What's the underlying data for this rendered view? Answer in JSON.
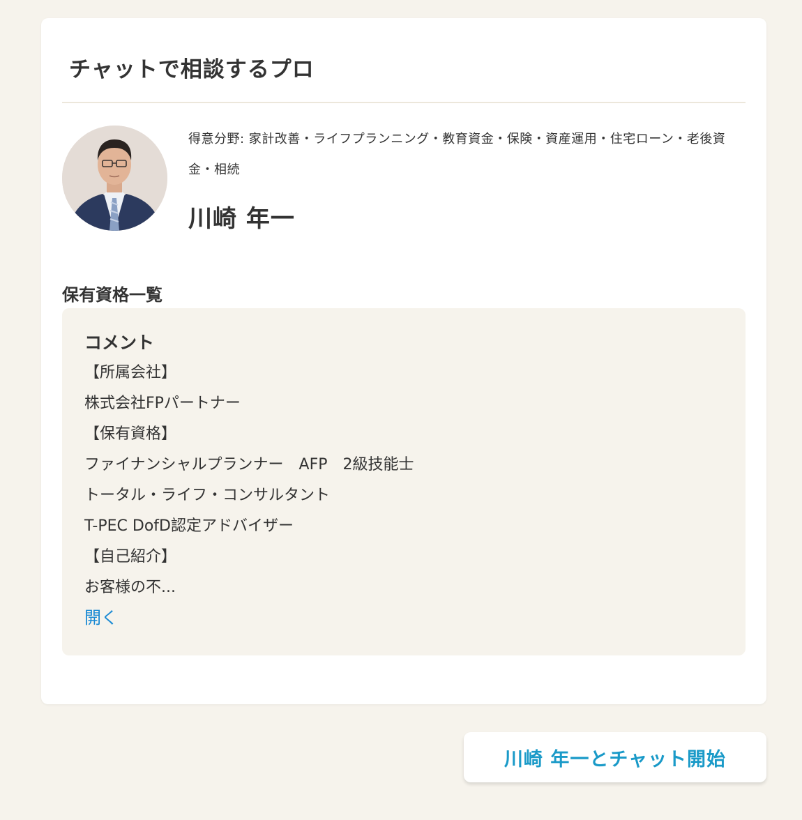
{
  "card": {
    "title": "チャットで相談するプロ"
  },
  "pro": {
    "specialty": "得意分野: 家計改善・ライフプランニング・教育資金・保険・資産運用・住宅ローン・老後資金・相続",
    "name": "川崎 年一",
    "avatar_icon": "profile-photo"
  },
  "qualifications": {
    "heading": "保有資格一覧"
  },
  "comment": {
    "heading": "コメント",
    "lines": [
      "【所属会社】",
      "株式会社FPパートナー",
      "【保有資格】",
      "ファイナンシャルプランナー　AFP　2級技能士",
      "トータル・ライフ・コンサルタント",
      "T-PEC DofD認定アドバイザー",
      "【自己紹介】",
      "お客様の不..."
    ],
    "open_label": "開く"
  },
  "actions": {
    "chat_button_label": "川崎 年一とチャット開始"
  },
  "colors": {
    "page_background": "#f6f3ec",
    "card_background": "#ffffff",
    "comment_background": "#f6f3ec",
    "link": "#1a8ad4",
    "button_text": "#1a9ac8",
    "text": "#333333"
  }
}
